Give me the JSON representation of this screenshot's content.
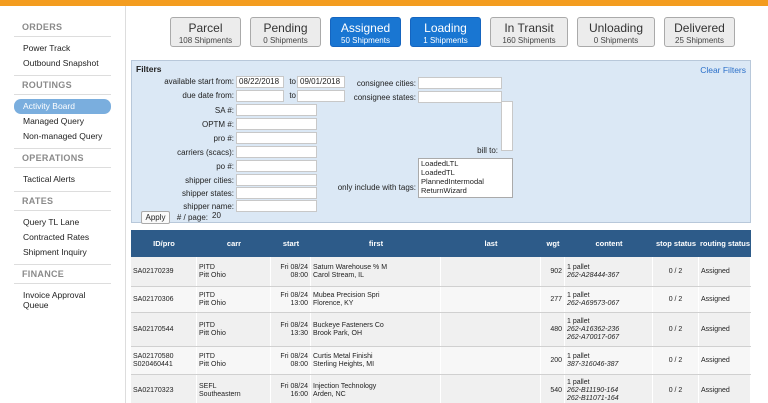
{
  "sidebar": {
    "sections": [
      {
        "title": "ORDERS",
        "items": [
          "Power Track",
          "Outbound Snapshot"
        ]
      },
      {
        "title": "ROUTINGS",
        "items": [
          "Activity Board",
          "Managed Query",
          "Non-managed Query"
        ]
      },
      {
        "title": "OPERATIONS",
        "items": [
          "Tactical Alerts"
        ]
      },
      {
        "title": "RATES",
        "items": [
          "Query TL Lane",
          "Contracted Rates",
          "Shipment Inquiry"
        ]
      },
      {
        "title": "FINANCE",
        "items": [
          "Invoice Approval",
          "Queue"
        ]
      }
    ]
  },
  "tabs": [
    {
      "title": "Parcel",
      "sub": "108 Shipments"
    },
    {
      "title": "Pending",
      "sub": "0 Shipments"
    },
    {
      "title": "Assigned",
      "sub": "50 Shipments"
    },
    {
      "title": "Loading",
      "sub": "1 Shipments"
    },
    {
      "title": "In Transit",
      "sub": "160 Shipments"
    },
    {
      "title": "Unloading",
      "sub": "0 Shipments"
    },
    {
      "title": "Delivered",
      "sub": "25 Shipments"
    }
  ],
  "filters": {
    "title": "Filters",
    "clear": "Clear Filters",
    "available_start_label": "available start from:",
    "available_start_from": "08/22/2018",
    "to_label": "to",
    "available_start_to": "09/01/2018",
    "due_date_label": "due date from:",
    "due_to_label": "to",
    "sa_label": "SA #:",
    "optm_label": "OPTM #:",
    "pro_label": "pro #:",
    "carriers_label": "carriers (scacs):",
    "po_label": "po #:",
    "shipper_cities_label": "shipper cities:",
    "shipper_states_label": "shipper states:",
    "shipper_name_label": "shipper name:",
    "consignee_cities_label": "consignee cities:",
    "consignee_states_label": "consignee states:",
    "bill_to_label": "bill to:",
    "tags_label": "only include with tags:",
    "tags": [
      "LoadedLTL",
      "LoadedTL",
      "PlannedIntermodal",
      "ReturnWizard"
    ],
    "apply": "Apply",
    "per_page_label": "# / page:",
    "per_page": "20"
  },
  "table": {
    "headers": [
      "ID/pro",
      "carr",
      "start",
      "first",
      "last",
      "wgt",
      "content",
      "stop status",
      "routing status"
    ],
    "rows": [
      {
        "id": "SA02170239",
        "id2": "",
        "carr": "PITD",
        "carr2": "Pitt Ohio",
        "date": "Fri 08/24",
        "time": "08:00",
        "first": "Saturn Warehouse % M",
        "first2": "Carol Stream, IL",
        "wgt": "902",
        "c1": "1 pallet",
        "c2": "262-A28444-367",
        "c3": "",
        "stop": "0 / 2",
        "routing": "Assigned"
      },
      {
        "id": "SA02170306",
        "id2": "",
        "carr": "PITD",
        "carr2": "Pitt Ohio",
        "date": "Fri 08/24",
        "time": "13:00",
        "first": "Mubea Precision Spri",
        "first2": "Florence, KY",
        "wgt": "277",
        "c1": "1 pallet",
        "c2": "262-A69573-067",
        "c3": "",
        "stop": "0 / 2",
        "routing": "Assigned"
      },
      {
        "id": "SA02170544",
        "id2": "",
        "carr": "PITD",
        "carr2": "Pitt Ohio",
        "date": "Fri 08/24",
        "time": "13:30",
        "first": "Buckeye Fasteners Co",
        "first2": "Brook Park, OH",
        "wgt": "480",
        "c1": "1 pallet",
        "c2": "262-A16362-236",
        "c3": "262-A70017-067",
        "stop": "0 / 2",
        "routing": "Assigned"
      },
      {
        "id": "SA02170580",
        "id2": "S020460441",
        "carr": "PITD",
        "carr2": "Pitt Ohio",
        "date": "Fri 08/24",
        "time": "08:00",
        "first": "Curtis Metal Finishi",
        "first2": "Sterling Heights, MI",
        "wgt": "200",
        "c1": "1 pallet",
        "c2": "387-316046-387",
        "c3": "",
        "stop": "0 / 2",
        "routing": "Assigned"
      },
      {
        "id": "SA02170323",
        "id2": "",
        "carr": "SEFL",
        "carr2": "Southeastern",
        "date": "Fri 08/24",
        "time": "16:00",
        "first": "Injection Technology",
        "first2": "Arden, NC",
        "wgt": "540",
        "c1": "1 pallet",
        "c2": "262-B11190-164",
        "c3": "262-B11071-164",
        "stop": "0 / 2",
        "routing": "Assigned"
      }
    ]
  }
}
